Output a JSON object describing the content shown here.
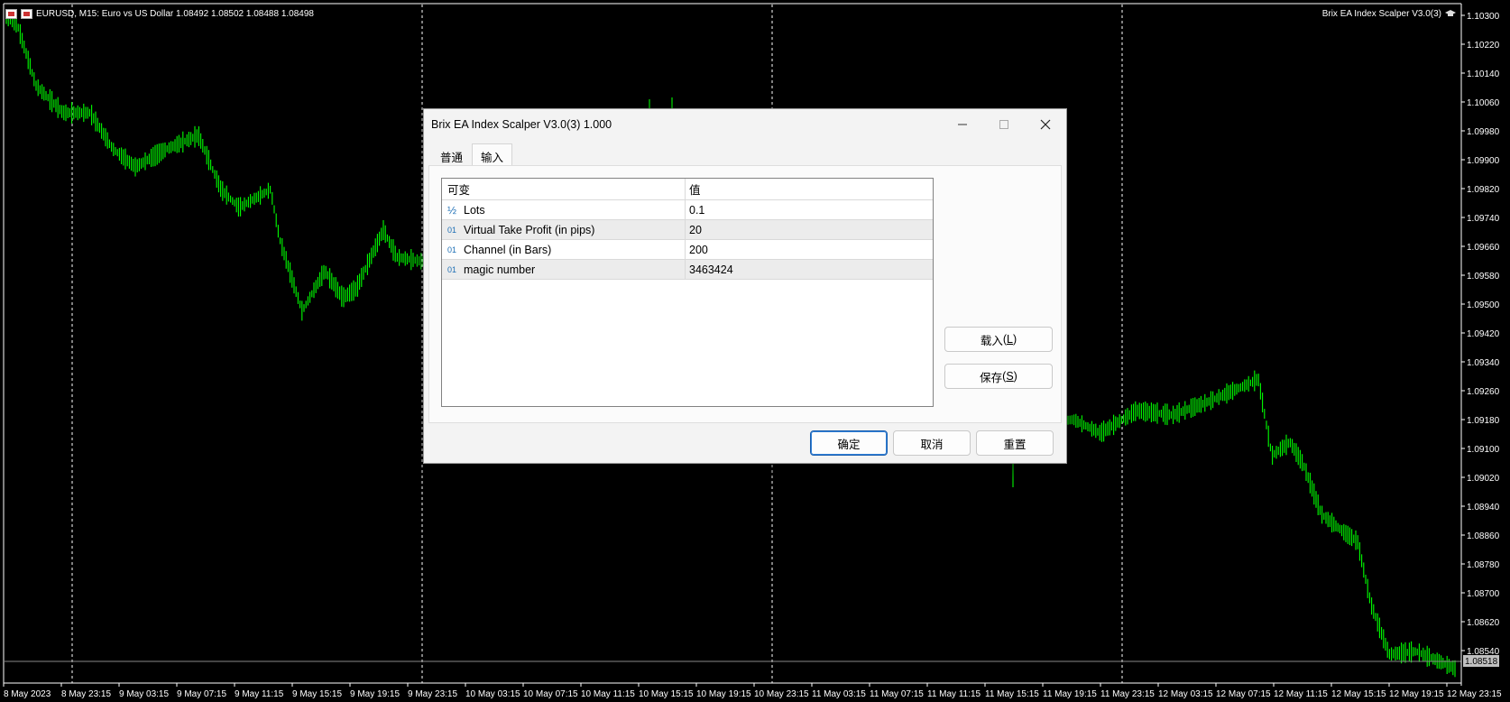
{
  "chart": {
    "symbol_info": "EURUSD, M15:  Euro vs US Dollar  1.08492 1.08502 1.08488 1.08498",
    "ea_label": "Brix EA Index Scalper V3.0(3)",
    "price_axis": [
      "1.10300",
      "1.10220",
      "1.10140",
      "1.10060",
      "1.09980",
      "1.09900",
      "1.09820",
      "1.09740",
      "1.09660",
      "1.09580",
      "1.09500",
      "1.09420",
      "1.09340",
      "1.09260",
      "1.09180",
      "1.09100",
      "1.09020",
      "1.08940",
      "1.08860",
      "1.08780",
      "1.08700",
      "1.08620",
      "1.08540"
    ],
    "current_price": "1.08518",
    "time_axis": [
      "8 May 2023",
      "8 May 23:15",
      "9 May 03:15",
      "9 May 07:15",
      "9 May 11:15",
      "9 May 15:15",
      "9 May 19:15",
      "9 May 23:15",
      "10 May 03:15",
      "10 May 07:15",
      "10 May 11:15",
      "10 May 15:15",
      "10 May 19:15",
      "10 May 23:15",
      "11 May 03:15",
      "11 May 07:15",
      "11 May 11:15",
      "11 May 15:15",
      "11 May 19:15",
      "11 May 23:15",
      "12 May 03:15",
      "12 May 07:15",
      "12 May 11:15",
      "12 May 15:15",
      "12 May 19:15",
      "12 May 23:15"
    ],
    "candle_color": "#00ff00",
    "grid_color": "#ffffff"
  },
  "dialog": {
    "title": "Brix EA Index Scalper V3.0(3) 1.000",
    "tabs": [
      {
        "label": "普通"
      },
      {
        "label": "输入"
      }
    ],
    "params_header": {
      "name": "可变",
      "value": "值"
    },
    "params": [
      {
        "type_icon": "½",
        "name": "Lots",
        "value": "0.1"
      },
      {
        "type_icon": "01",
        "name": "Virtual Take Profit (in pips)",
        "value": "20"
      },
      {
        "type_icon": "01",
        "name": "Channel (in Bars)",
        "value": "200"
      },
      {
        "type_icon": "01",
        "name": "magic number",
        "value": "3463424"
      }
    ],
    "load_button": {
      "label": "载入",
      "hotkey": "L"
    },
    "save_button": {
      "label": "保存",
      "hotkey": "S"
    },
    "ok_button": "确定",
    "cancel_button": "取消",
    "reset_button": "重置"
  }
}
